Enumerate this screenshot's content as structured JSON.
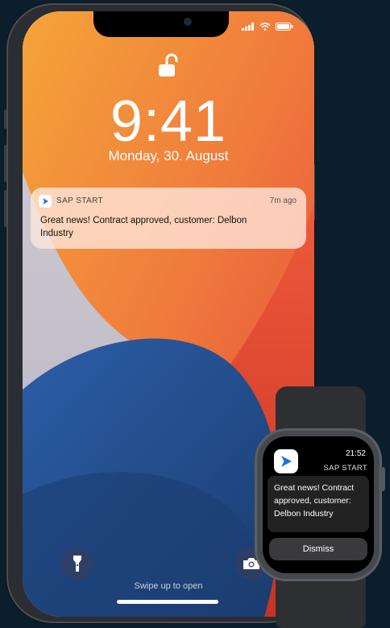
{
  "phone": {
    "status": {
      "signal_icon": "signal-bars-icon",
      "wifi_icon": "wifi-icon",
      "battery_icon": "battery-icon"
    },
    "lock_icon": "unlocked-padlock-icon",
    "time": "9:41",
    "date": "Monday, 30. August",
    "notification": {
      "app_name": "SAP START",
      "time_ago": "7m ago",
      "message": "Great news! Contract approved, customer: Delbon Industry"
    },
    "flashlight_icon": "flashlight-icon",
    "camera_icon": "camera-icon",
    "swipe_hint": "Swipe up to open"
  },
  "watch": {
    "time": "21:52",
    "app_name": "SAP START",
    "message": "Great news! Contract approved, customer: Delbon Industry",
    "dismiss_label": "Dismiss"
  },
  "colors": {
    "background": "#0b1e2c",
    "brand_blue": "#1f6fe0",
    "notification_bg": "#ffe8de"
  }
}
